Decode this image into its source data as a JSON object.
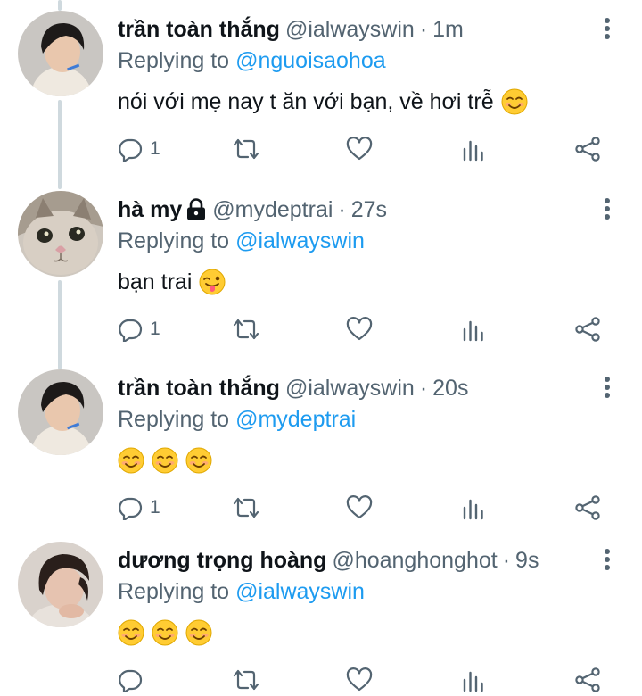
{
  "colors": {
    "name": "#0f1419",
    "secondary": "#536471",
    "mention": "#1d9bf0",
    "thread_line": "#cfd9de",
    "emoji_face": "#ffcc33"
  },
  "icons": {
    "reply": "reply-icon",
    "retweet": "retweet-icon",
    "like": "heart-icon",
    "analytics": "analytics-icon",
    "share": "share-icon",
    "menu": "more-vertical-icon",
    "lock": "lock-icon"
  },
  "tweets": [
    {
      "name": "trần toàn thắng",
      "handle": "@ialwayswin",
      "separator": "·",
      "time": "1m",
      "replying_label": "Replying to",
      "replying_to": "@nguoisaohoa",
      "text": "nói với mẹ nay t ăn với bạn, về hơi trễ",
      "emojis": [
        "smiling-face-emoji"
      ],
      "reply_count": "1",
      "protected": false
    },
    {
      "name": "hà my",
      "handle": "@mydeptrai",
      "separator": "·",
      "time": "27s",
      "replying_label": "Replying to",
      "replying_to": "@ialwayswin",
      "text": "bạn trai",
      "emojis": [
        "winking-tongue-emoji"
      ],
      "reply_count": "1",
      "protected": true
    },
    {
      "name": "trần toàn thắng",
      "handle": "@ialwayswin",
      "separator": "·",
      "time": "20s",
      "replying_label": "Replying to",
      "replying_to": "@mydeptrai",
      "text": "",
      "emojis": [
        "smiling-face-emoji",
        "smiling-face-emoji",
        "smiling-face-emoji"
      ],
      "reply_count": "1",
      "protected": false
    },
    {
      "name": "dương trọng hoàng",
      "handle": "@hoanghonghot",
      "separator": "·",
      "time": "9s",
      "replying_label": "Replying to",
      "replying_to": "@ialwayswin",
      "text": "",
      "emojis": [
        "smiling-face-emoji",
        "smiling-face-emoji",
        "smiling-face-emoji"
      ],
      "reply_count": "",
      "protected": false
    }
  ]
}
